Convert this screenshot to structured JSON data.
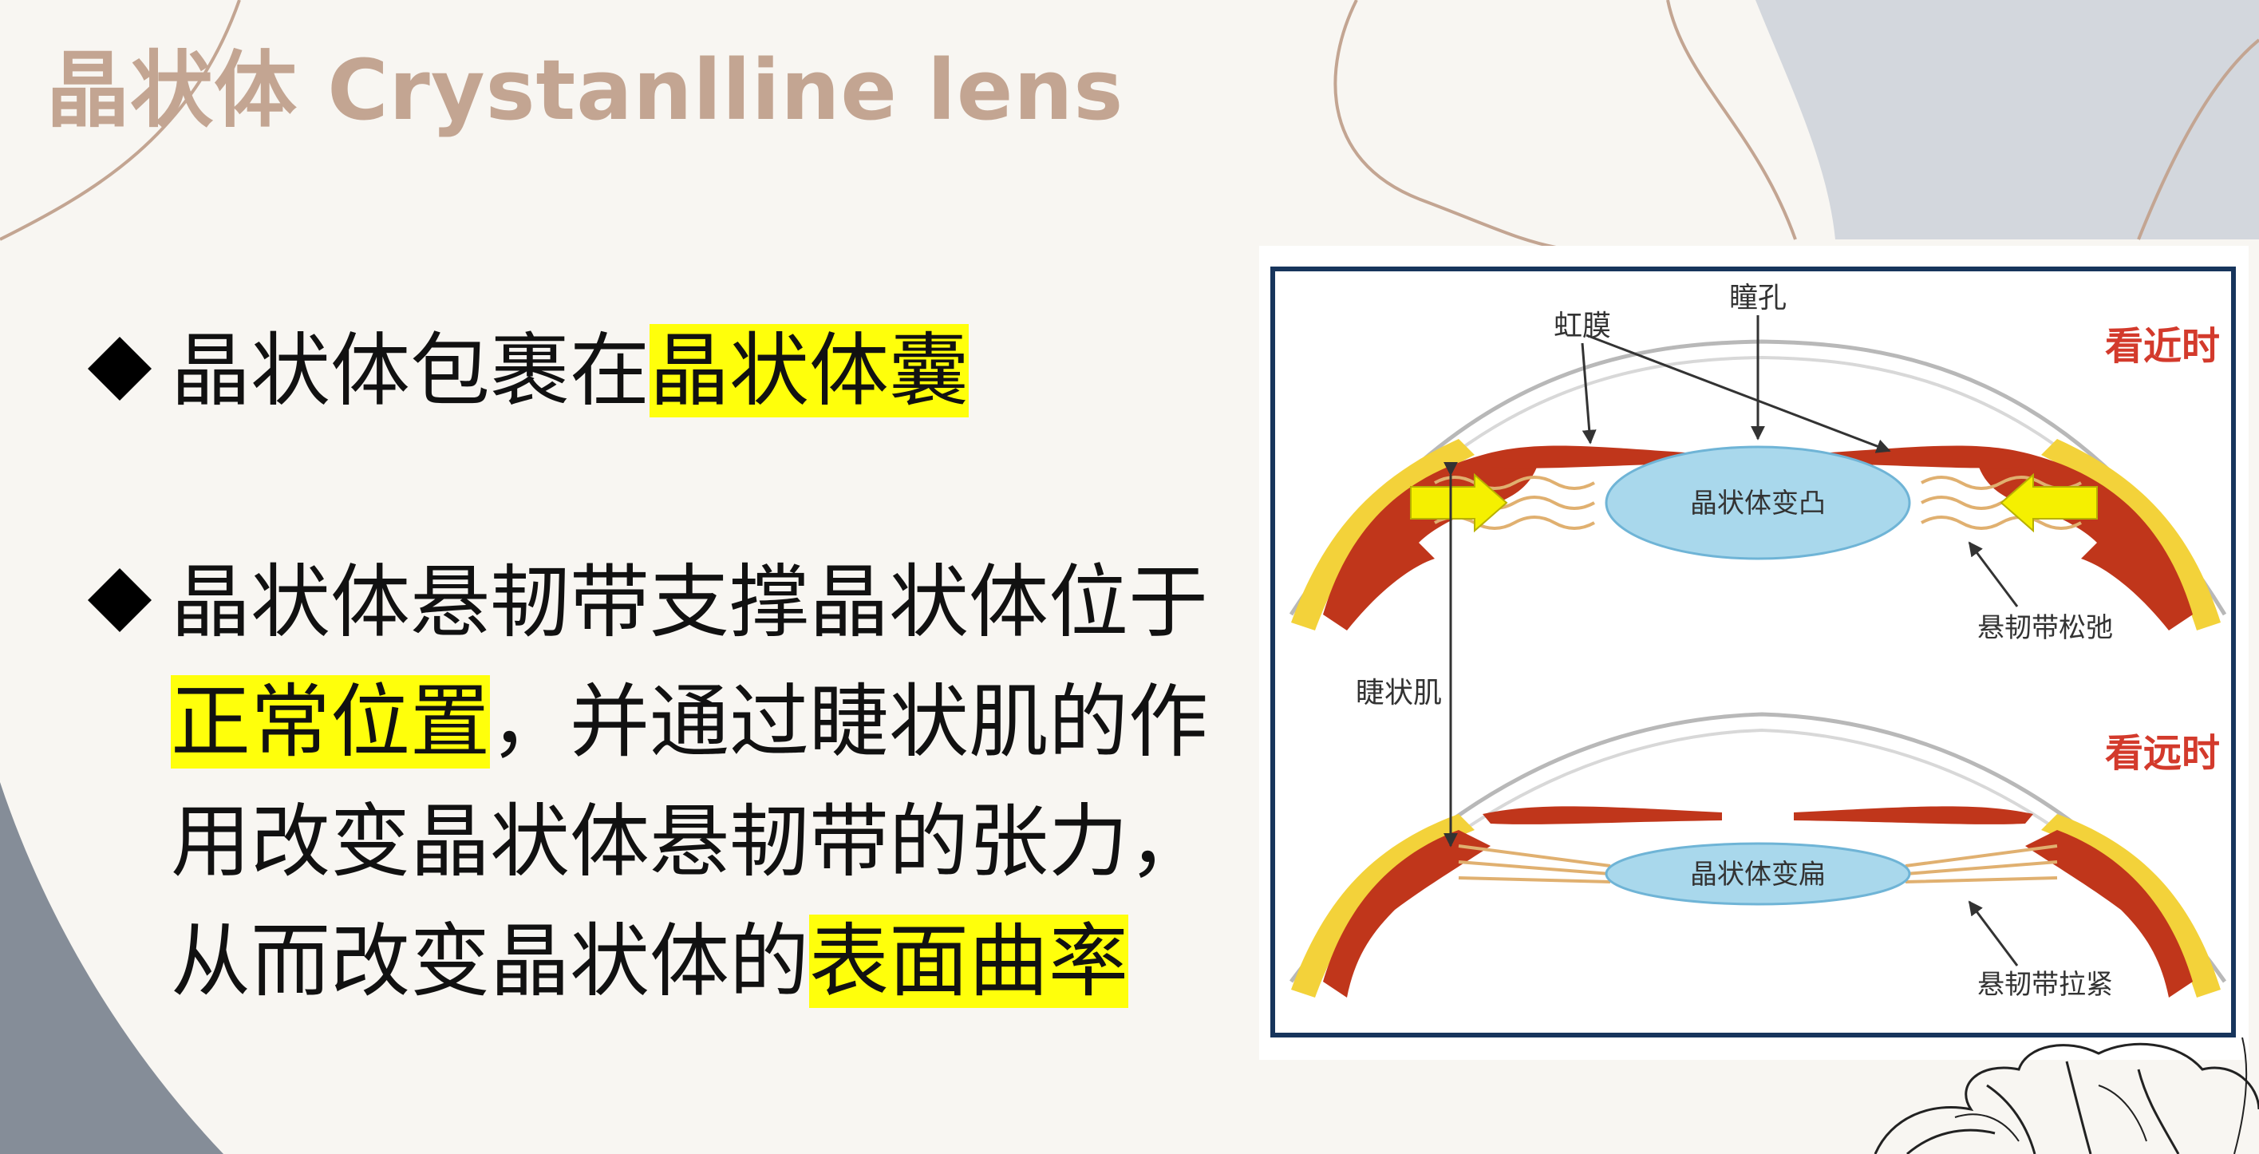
{
  "slide": {
    "title": "晶状体 Crystanlline lens",
    "colors": {
      "title": "#c3a592",
      "highlight": "#ffff0b",
      "frame": "#17355c",
      "muscle": "#c0361b",
      "lens": "#a9d8ec",
      "arrow": "#f5f000"
    },
    "bullets": [
      {
        "plain": "晶状体包裹在",
        "highlight": "晶状体囊"
      },
      {
        "line1": "晶状体悬韧带支撑晶状体位于",
        "line2_highlight": "正常位置",
        "line2_rest": "，并通过睫状肌的作",
        "line3": "用改变晶状体悬韧带的张力，",
        "line4_plain": "从而改变晶状体的",
        "line4_highlight": "表面曲率"
      }
    ]
  },
  "figure": {
    "labels": {
      "pupil": "瞳孔",
      "iris": "虹膜",
      "near_title": "看近时",
      "lens_convex": "晶状体变凸",
      "zonule_relaxed": "悬韧带松弛",
      "ciliary_muscle": "睫状肌",
      "far_title": "看远时",
      "lens_flat": "晶状体变扁",
      "zonule_tight": "悬韧带拉紧"
    }
  }
}
